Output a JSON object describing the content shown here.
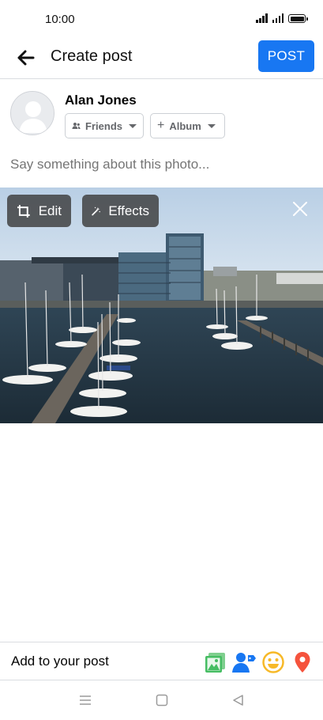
{
  "status_bar": {
    "time": "10:00"
  },
  "header": {
    "title": "Create post",
    "post_label": "POST"
  },
  "user": {
    "name": "Alan Jones"
  },
  "audience": {
    "friends_label": "Friends",
    "album_label": "Album"
  },
  "composer": {
    "placeholder": "Say something about this photo..."
  },
  "photo_controls": {
    "edit_label": "Edit",
    "effects_label": "Effects"
  },
  "add_bar": {
    "label": "Add to your post",
    "icons": [
      "photo-icon",
      "tag-people-icon",
      "feeling-icon",
      "location-icon"
    ]
  },
  "nav_bar": {
    "icons": [
      "menu-icon",
      "home-icon",
      "back-triangle-icon"
    ]
  },
  "colors": {
    "accent": "#1877f2",
    "photo_icon": "#45bd62",
    "tag_icon": "#1877f2",
    "feeling_icon": "#f7b928",
    "location_icon": "#f5533d"
  }
}
